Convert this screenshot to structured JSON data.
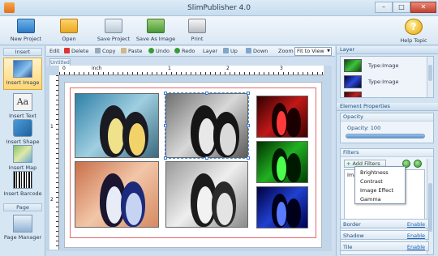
{
  "app": {
    "title": "SlimPublisher 4.0"
  },
  "toolbar": {
    "new_project": "New Project",
    "open": "Open",
    "save_project": "Save Project",
    "save_as_image": "Save As Image",
    "print": "Print",
    "help": "Help Topic",
    "help_glyph": "?"
  },
  "sidebar": {
    "insert_header": "Insert",
    "page_header": "Page",
    "insert_image": "Insert Image",
    "insert_text": "Insert Text",
    "insert_shape": "Insert Shape",
    "insert_map": "Insert Map",
    "insert_barcode": "Insert Barcode",
    "page_manager": "Page Manager",
    "text_glyph": "Aa"
  },
  "editbar": {
    "edit": "Edit",
    "delete": "Delete",
    "copy": "Copy",
    "paste": "Paste",
    "undo": "Undo",
    "redo": "Redo",
    "layer": "Layer",
    "up": "Up",
    "down": "Down",
    "zoom": "Zoom",
    "zoom_value": "Fit to View"
  },
  "document": {
    "tab": "Untitled",
    "ruler_unit": "inch",
    "ruler_h": [
      "1",
      "2",
      "3"
    ],
    "ruler_v": [
      "1",
      "2"
    ]
  },
  "layer_panel": {
    "title": "Layer",
    "items": [
      {
        "label": "Type:Image"
      },
      {
        "label": "Type:Image"
      }
    ]
  },
  "element_properties": {
    "title": "Element Properties",
    "opacity_header": "Opacity",
    "opacity_label": "Opacity:",
    "opacity_value": "100",
    "opacity_fraction": 1.0,
    "filters_header": "Filters",
    "add_filters": "Add Filters",
    "filter_item": "Image",
    "border": "Border",
    "shadow": "Shadow",
    "tile": "Tile",
    "enable": "Enable"
  },
  "filter_menu": [
    "Brightness",
    "Contrast",
    "Image Effect",
    "Gamma"
  ],
  "colors": {
    "accent": "#4a8ad6",
    "margin": "#e06a6a",
    "panel_bg": "#d3e3f2"
  }
}
